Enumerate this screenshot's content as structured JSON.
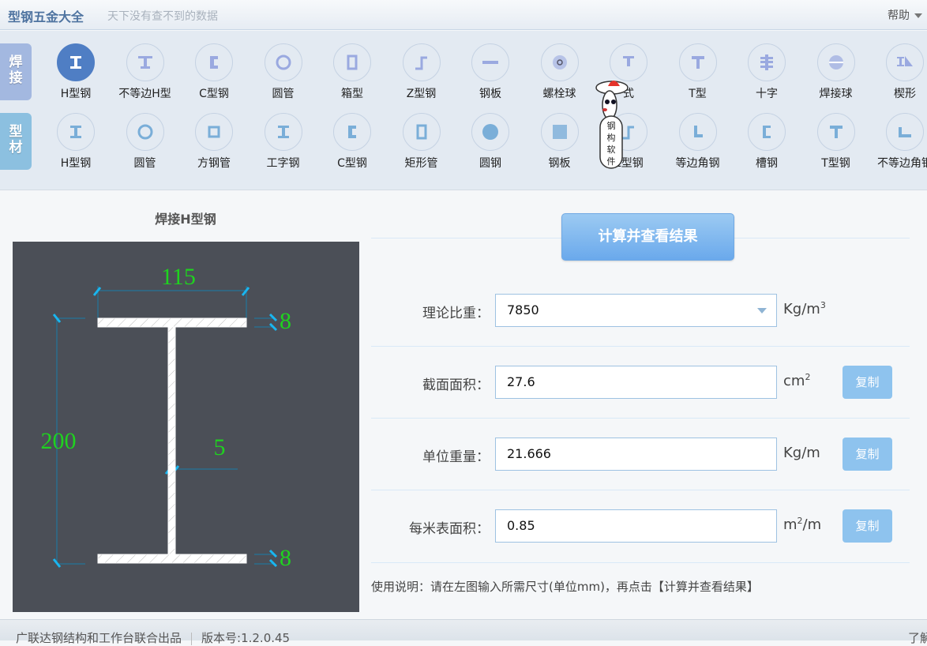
{
  "app": {
    "title": "型钢五金大全",
    "slogan": "天下没有查不到的数据",
    "help_menu": "帮助"
  },
  "toolbar": {
    "categories": [
      {
        "label": "焊接"
      },
      {
        "label": "型材"
      }
    ],
    "weld_shapes": [
      {
        "label": "H型钢",
        "icon": "h-beam-icon",
        "active": true
      },
      {
        "label": "不等边H型",
        "icon": "unequal-h-beam-icon"
      },
      {
        "label": "C型钢",
        "icon": "c-channel-icon"
      },
      {
        "label": "圆管",
        "icon": "round-pipe-icon"
      },
      {
        "label": "箱型",
        "icon": "box-section-icon"
      },
      {
        "label": "Z型钢",
        "icon": "z-section-icon"
      },
      {
        "label": "钢板",
        "icon": "steel-plate-icon"
      },
      {
        "label": "螺栓球",
        "icon": "bolt-ball-icon"
      },
      {
        "label": "式",
        "icon": "partially-hidden-icon"
      },
      {
        "label": "T型",
        "icon": "t-section-icon"
      },
      {
        "label": "十字",
        "icon": "cross-section-icon"
      },
      {
        "label": "焊接球",
        "icon": "welded-ball-icon"
      },
      {
        "label": "楔形",
        "icon": "wedge-icon"
      }
    ],
    "profile_shapes": [
      {
        "label": "H型钢",
        "icon": "h-beam-icon"
      },
      {
        "label": "圆管",
        "icon": "round-pipe-icon"
      },
      {
        "label": "方钢管",
        "icon": "square-tube-icon"
      },
      {
        "label": "工字钢",
        "icon": "i-beam-icon"
      },
      {
        "label": "C型钢",
        "icon": "c-channel-icon"
      },
      {
        "label": "矩形管",
        "icon": "rect-tube-icon"
      },
      {
        "label": "圆钢",
        "icon": "round-bar-icon"
      },
      {
        "label": "钢板",
        "icon": "checker-plate-icon"
      },
      {
        "label": "Z型钢",
        "icon": "z-section-icon"
      },
      {
        "label": "等边角钢",
        "icon": "equal-angle-icon"
      },
      {
        "label": "槽钢",
        "icon": "channel-icon"
      },
      {
        "label": "T型钢",
        "icon": "t-section-icon"
      },
      {
        "label": "不等边角钢",
        "icon": "unequal-angle-icon"
      }
    ],
    "mascot_text": "钢构软件"
  },
  "figure": {
    "title": "焊接H型钢",
    "dims": {
      "width": "115",
      "height": "200",
      "web_thickness": "5",
      "top_flange": "8",
      "bottom_flange": "8"
    },
    "colors": {
      "dim_text": "#1fd31f",
      "dim_line": "#1a7ea8",
      "tick": "#19b6f0",
      "bg": "#4b4f57"
    }
  },
  "calc": {
    "button": "计算并查看结果",
    "rows": [
      {
        "label": "理论比重：",
        "value": "7850",
        "unit": "Kg/m",
        "sup": "3",
        "unit_after": "",
        "dropdown": true
      },
      {
        "label": "截面面积：",
        "value": "27.6",
        "unit": "cm",
        "sup": "2",
        "unit_after": "",
        "copy": "复制"
      },
      {
        "label": "单位重量：",
        "value": "21.666",
        "unit": "Kg/m",
        "sup": "",
        "unit_after": "",
        "copy": "复制"
      },
      {
        "label": "每米表面积：",
        "value": "0.85",
        "unit": "m",
        "sup": "2",
        "unit_after": "/m",
        "copy": "复制"
      }
    ],
    "note": "使用说明：请在左图输入所需尺寸(单位mm)，再点击【计算并查看结果】"
  },
  "status": {
    "producer": "广联达钢结构和工作台联合出品",
    "version": "版本号:1.2.0.45",
    "right": "了解"
  }
}
